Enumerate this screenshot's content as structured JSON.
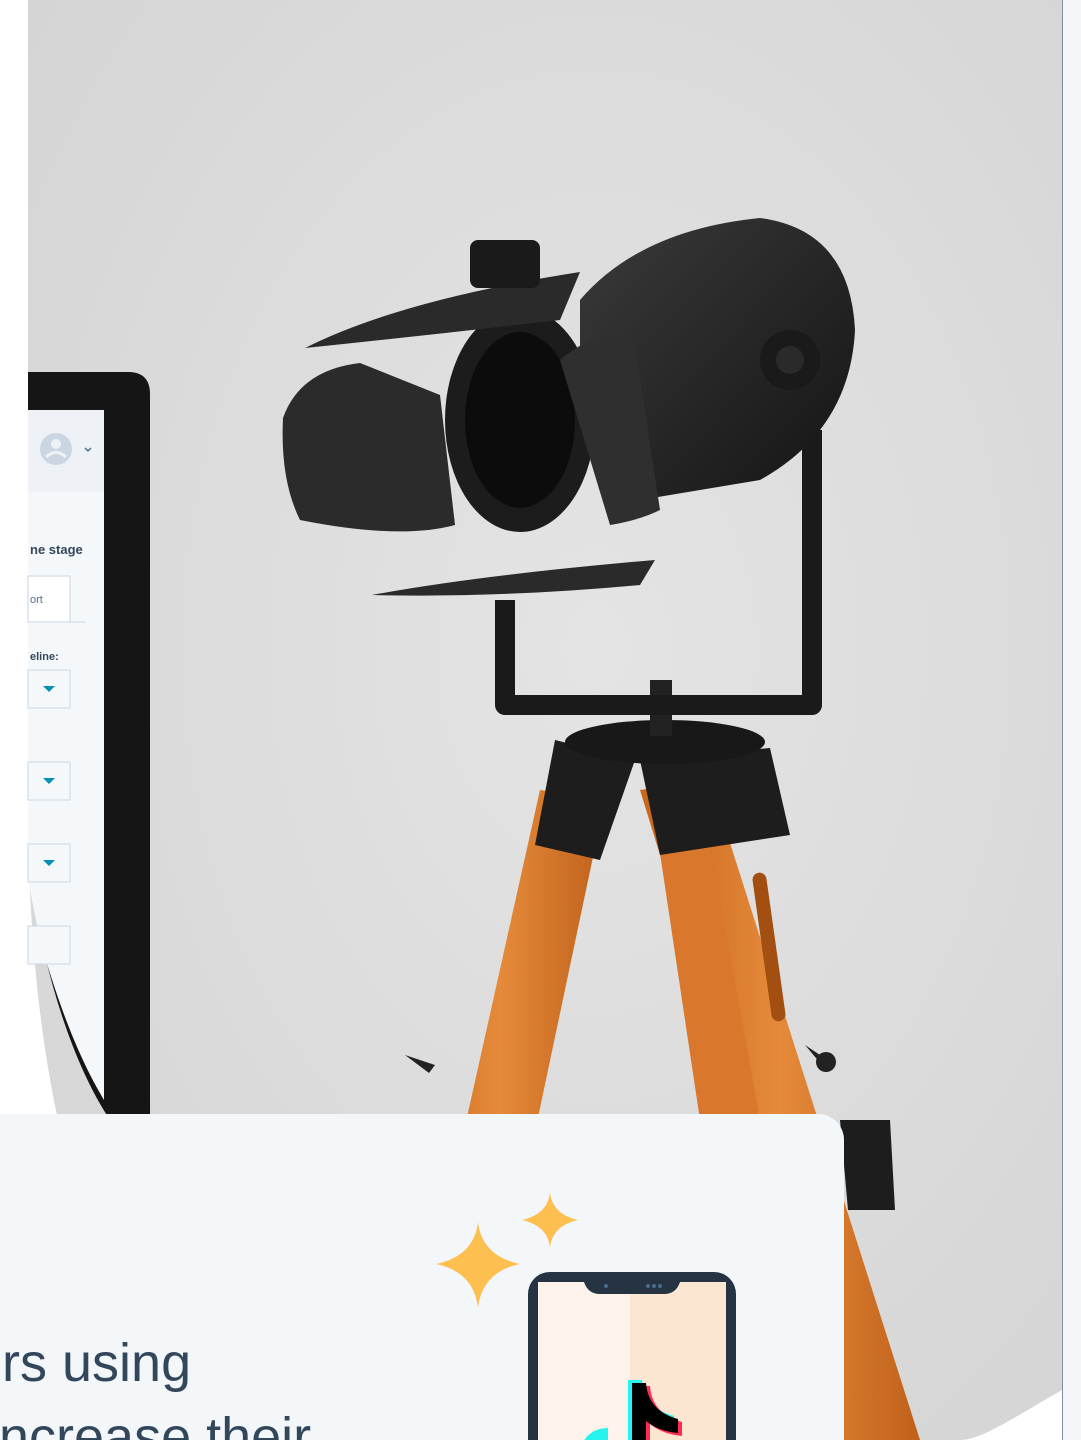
{
  "monitor_ui": {
    "stage_label": "ne stage",
    "tab_label": "ort",
    "pipeline_label": "eline:"
  },
  "card": {
    "line1": "ers using",
    "line2": "l increase their"
  },
  "colors": {
    "card_bg": "#f4f7fa",
    "text": "#33475b",
    "sparkle": "#fdbf4f",
    "accent_teal": "#00bda5",
    "wall": "#dedede"
  },
  "icons": [
    "sparkle-large-icon",
    "sparkle-small-icon",
    "phone-icon",
    "tiktok-logo-icon",
    "avatar-icon",
    "chevron-down-icon",
    "dropdown-arrow-icon"
  ]
}
